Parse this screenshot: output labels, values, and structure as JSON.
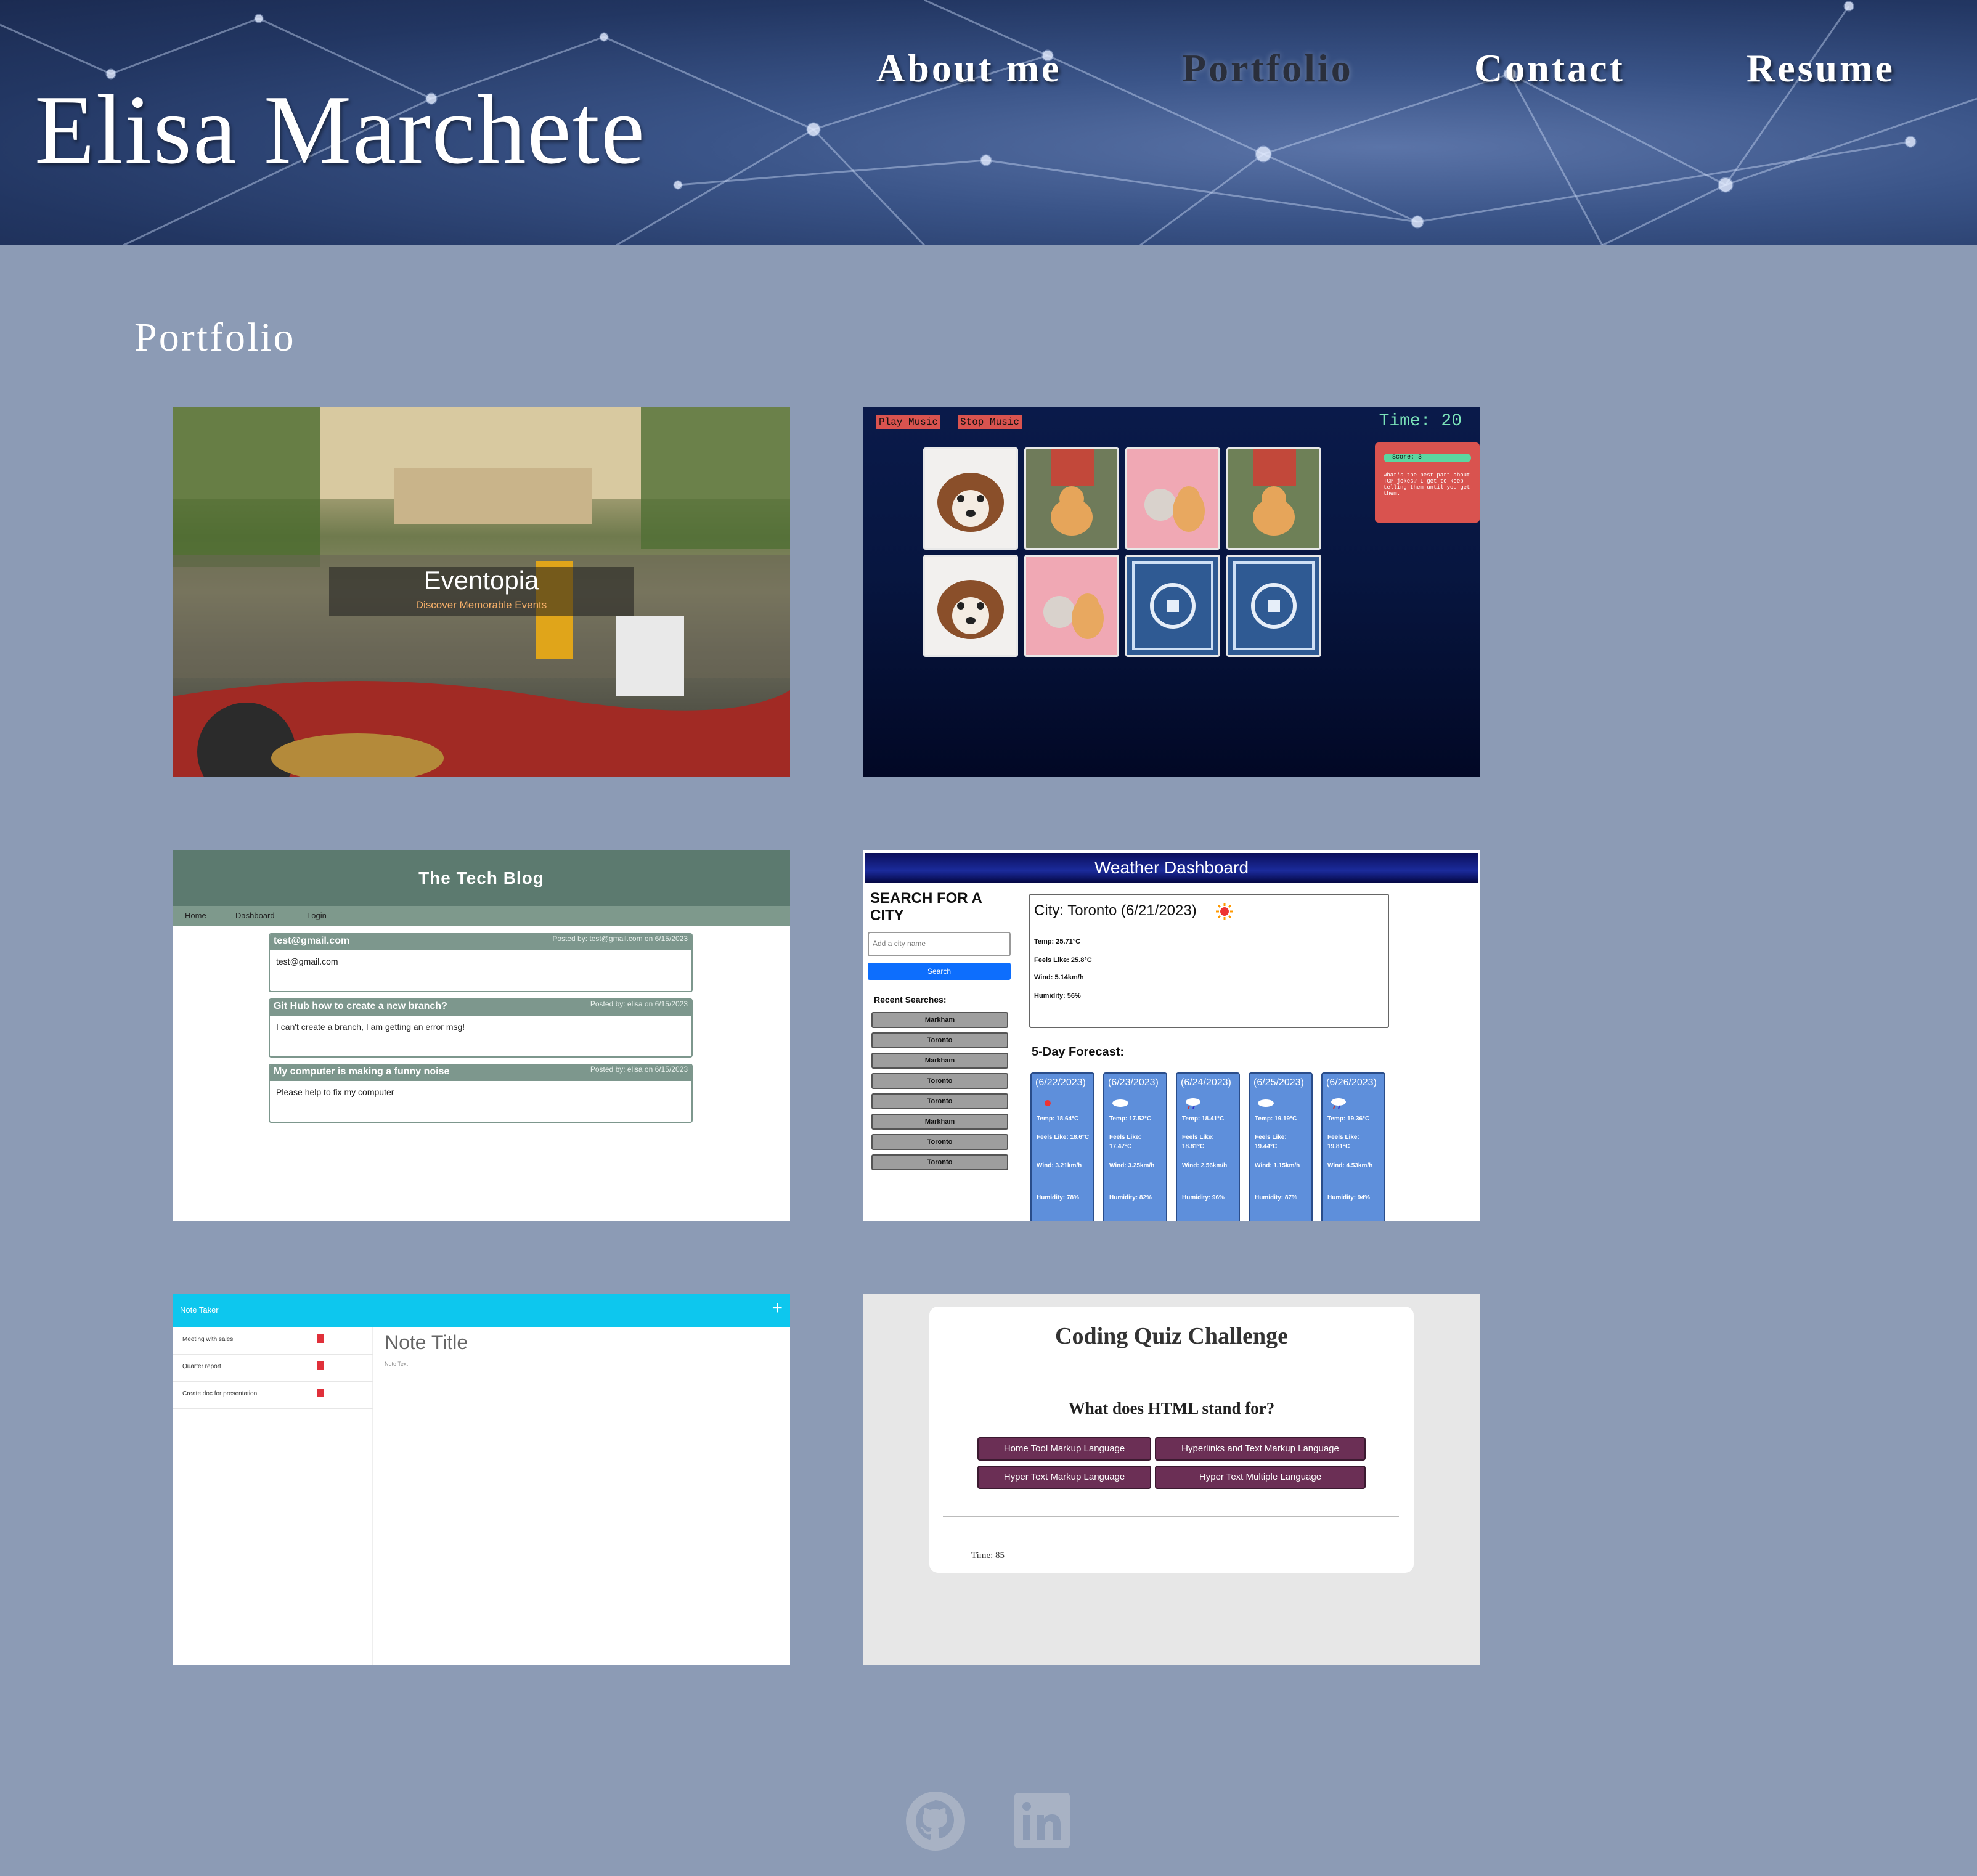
{
  "header": {
    "brand": "Elisa Marchete",
    "nav": [
      {
        "label": "About me",
        "active": false
      },
      {
        "label": "Portfolio",
        "active": true
      },
      {
        "label": "Contact",
        "active": false
      },
      {
        "label": "Resume",
        "active": false
      }
    ]
  },
  "section_title": "Portfolio",
  "projects": {
    "eventopia": {
      "title": "Eventopia",
      "subtitle": "Discover Memorable Events"
    },
    "memory_game": {
      "play_label": "Play Music",
      "stop_label": "Stop Music",
      "time": "Time: 20",
      "score": "Score: 3",
      "joke": "What's the best part about TCP jokes? I get to keep telling them until you get them."
    },
    "tech_blog": {
      "title": "The Tech Blog",
      "nav": [
        "Home",
        "Dashboard",
        "Login"
      ],
      "posts": [
        {
          "title": "test@gmail.com",
          "meta": "Posted by: test@gmail.com on 6/15/2023",
          "body": "test@gmail.com"
        },
        {
          "title": "Git Hub how to create a new branch?",
          "meta": "Posted by: elisa on 6/15/2023",
          "body": "I can't create a branch, I am getting an error msg!"
        },
        {
          "title": "My computer is making a funny noise",
          "meta": "Posted by: elisa on 6/15/2023",
          "body": "Please help to fix my computer"
        }
      ]
    },
    "weather": {
      "title": "Weather Dashboard",
      "search_heading": "SEARCH FOR A CITY",
      "input_placeholder": "Add a city name",
      "search_label": "Search",
      "recent_label": "Recent Searches:",
      "recent": [
        "Markham",
        "Toronto",
        "Markham",
        "Toronto",
        "Toronto",
        "Markham",
        "Toronto",
        "Toronto"
      ],
      "current": {
        "city": "City: Toronto (6/21/2023)",
        "temp": "Temp: 25.71°C",
        "feels": "Feels Like: 25.8°C",
        "wind": "Wind: 5.14km/h",
        "humidity": "Humidity: 56%"
      },
      "forecast_label": "5-Day Forecast:",
      "forecast": [
        {
          "date": "(6/22/2023)",
          "temp": "Temp: 18.64°C",
          "feels": "Feels Like: 18.6°C",
          "wind": "Wind: 3.21km/h",
          "humidity": "Humidity: 78%"
        },
        {
          "date": "(6/23/2023)",
          "temp": "Temp: 17.52°C",
          "feels": "Feels Like: 17.47°C",
          "wind": "Wind: 3.25km/h",
          "humidity": "Humidity: 82%"
        },
        {
          "date": "(6/24/2023)",
          "temp": "Temp: 18.41°C",
          "feels": "Feels Like: 18.81°C",
          "wind": "Wind: 2.56km/h",
          "humidity": "Humidity: 96%"
        },
        {
          "date": "(6/25/2023)",
          "temp": "Temp: 19.19°C",
          "feels": "Feels Like: 19.44°C",
          "wind": "Wind: 1.15km/h",
          "humidity": "Humidity: 87%"
        },
        {
          "date": "(6/26/2023)",
          "temp": "Temp: 19.36°C",
          "feels": "Feels Like: 19.81°C",
          "wind": "Wind: 4.53km/h",
          "humidity": "Humidity: 94%"
        }
      ]
    },
    "note_taker": {
      "title": "Note Taker",
      "add": "+",
      "notes": [
        "Meeting with sales",
        "Quarter report",
        "Create doc for presentation"
      ],
      "note_title": "Note Title",
      "note_text": "Note Text"
    },
    "quiz": {
      "title": "Coding Quiz Challenge",
      "question": "What does HTML stand for?",
      "answers": [
        "Home Tool Markup Language",
        "Hyperlinks and Text Markup Language",
        "Hyper Text Markup Language",
        "Hyper Text Multiple Language"
      ],
      "time": "Time: 85"
    }
  },
  "footer": {
    "icons": [
      "github-icon",
      "linkedin-icon"
    ]
  },
  "colors": {
    "page_bg": "#8c9bb5",
    "header_bg": "#2c4374",
    "quiz_button": "#6b2f55",
    "note_header": "#0dc7ee",
    "blog_header": "#5c7a6f"
  }
}
